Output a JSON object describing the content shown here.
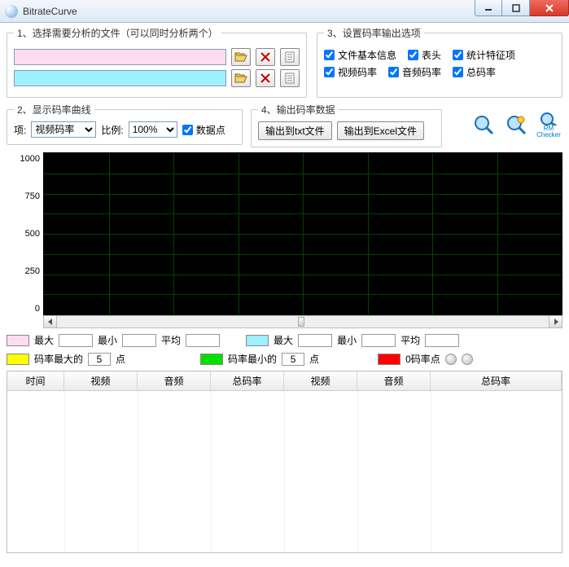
{
  "window": {
    "title": "BitrateCurve"
  },
  "group1": {
    "legend": "1、选择需要分析的文件（可以同时分析两个）"
  },
  "group3": {
    "legend": "3、设置码率输出选项",
    "opt_fileinfo": "文件基本信息",
    "opt_header": "表头",
    "opt_stats": "统计特征项",
    "opt_video": "视频码率",
    "opt_audio": "音频码率",
    "opt_total": "总码率"
  },
  "group2": {
    "legend": "2、显示码率曲线",
    "label_project": "项:",
    "sel_project": "视频码率",
    "label_ratio": "比例:",
    "sel_ratio": "100%",
    "chk_data": "数据点"
  },
  "group4": {
    "legend": "4、输出码率数据",
    "btn_txt": "输出到txt文件",
    "btn_excel": "输出到Excel文件"
  },
  "side": {
    "rmchecker_l1": "RM",
    "rmchecker_l2": "Checker"
  },
  "chart_data": {
    "type": "line",
    "title": "",
    "xlabel": "",
    "ylabel": "",
    "ylim": [
      0,
      1000
    ],
    "yticks": [
      0,
      250,
      500,
      750,
      1000
    ],
    "x_cols": 8,
    "series": []
  },
  "stats": {
    "max": "最大",
    "min": "最小",
    "avg": "平均",
    "rate_max_prefix": "码率最大的",
    "rate_min_prefix": "码率最小的",
    "points_suffix": "点",
    "zero_rate": "0码率点",
    "val_max_points": "5",
    "val_min_points": "5"
  },
  "table": {
    "col_time": "时间",
    "col_video": "视频",
    "col_audio": "音频",
    "col_total": "总码率"
  }
}
